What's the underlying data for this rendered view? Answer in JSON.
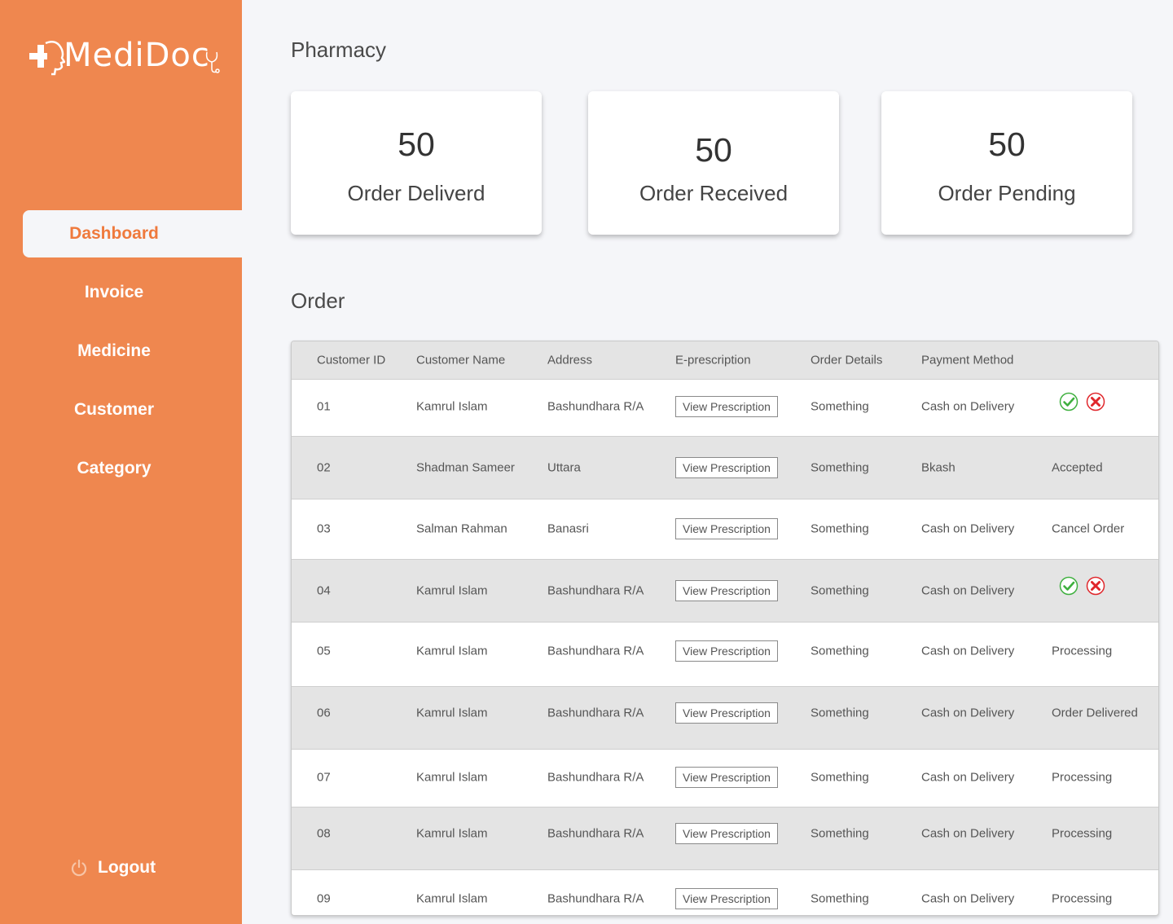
{
  "app": {
    "logo_text": "MediDoc"
  },
  "sidebar": {
    "items": [
      {
        "label": "Dashboard",
        "active": true
      },
      {
        "label": "Invoice"
      },
      {
        "label": "Medicine"
      },
      {
        "label": "Customer"
      },
      {
        "label": "Category"
      }
    ],
    "logout_label": "Logout"
  },
  "page": {
    "title": "Pharmacy",
    "order_section_title": "Order"
  },
  "stats": [
    {
      "value": "50",
      "label": "Order Deliverd"
    },
    {
      "value": "50",
      "label": "Order Received"
    },
    {
      "value": "50",
      "label": "Order Pending"
    }
  ],
  "table": {
    "columns": [
      "Customer ID",
      "Customer Name",
      "Address",
      "E-prescription",
      "Order Details",
      "Payment Method",
      ""
    ],
    "rows": [
      {
        "id": "01",
        "name": "Kamrul Islam",
        "address": "Bashundhara R/A",
        "prescription": "View Prescription",
        "details": "Something",
        "payment": "Cash on Delivery",
        "status": "",
        "actions": true
      },
      {
        "id": "02",
        "name": "Shadman Sameer",
        "address": "Uttara",
        "prescription": "View Prescription",
        "details": "Something",
        "payment": "Bkash",
        "status": "Accepted",
        "actions": false
      },
      {
        "id": "03",
        "name": "Salman Rahman",
        "address": "Banasri",
        "prescription": "View Prescription",
        "details": "Something",
        "payment": "Cash on Delivery",
        "status": "Cancel Order",
        "actions": false
      },
      {
        "id": "04",
        "name": "Kamrul Islam",
        "address": "Bashundhara R/A",
        "prescription": "View Prescription",
        "details": "Something",
        "payment": "Cash on Delivery",
        "status": "",
        "actions": true
      },
      {
        "id": "05",
        "name": "Kamrul Islam",
        "address": "Bashundhara R/A",
        "prescription": "View Prescription",
        "details": "Something",
        "payment": "Cash on Delivery",
        "status": "Processing",
        "actions": false
      },
      {
        "id": "06",
        "name": "Kamrul Islam",
        "address": "Bashundhara R/A",
        "prescription": "View Prescription",
        "details": "Something",
        "payment": "Cash on Delivery",
        "status": "Order Delivered",
        "actions": false
      },
      {
        "id": "07",
        "name": "Kamrul Islam",
        "address": "Bashundhara R/A",
        "prescription": "View Prescription",
        "details": "Something",
        "payment": "Cash on Delivery",
        "status": "Processing",
        "actions": false
      },
      {
        "id": "08",
        "name": "Kamrul Islam",
        "address": "Bashundhara R/A",
        "prescription": "View Prescription",
        "details": "Something",
        "payment": "Cash on Delivery",
        "status": "Processing",
        "actions": false
      },
      {
        "id": "09",
        "name": "Kamrul Islam",
        "address": "Bashundhara R/A",
        "prescription": "View Prescription",
        "details": "Something",
        "payment": "Cash on Delivery",
        "status": "Processing",
        "actions": false
      }
    ]
  },
  "icons": {
    "accept": "check-circle-icon",
    "reject": "x-circle-icon",
    "logout": "power-icon"
  },
  "colors": {
    "brand": "#ef874f",
    "accent_text": "#ef7a3d",
    "accept": "#3fb03f",
    "reject": "#e0262b"
  }
}
